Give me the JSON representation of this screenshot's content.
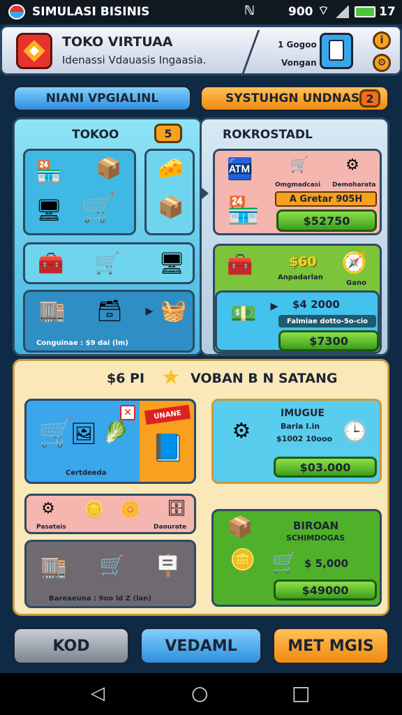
{
  "status_bar": {
    "app_title": "SIMULASI BISINIS",
    "signal_text": "900",
    "battery_text": "17"
  },
  "header": {
    "title": "TOKO VIRTUAA",
    "subtitle": "Idenassi Vdauasis Ingaasia.",
    "stat_line1": "1 Gogoo",
    "stat_line2": "Vongan"
  },
  "tabs": [
    {
      "label": "NIANI VPGIALINL",
      "color": "#3aa6ec"
    },
    {
      "label": "SYSTUHGN UNDNASIA",
      "badge": "2",
      "color": "#f9a01e"
    }
  ],
  "toko_panel": {
    "title": "TOKOO",
    "badge": "5",
    "caption": "Conguinae : $9 dai (lm)"
  },
  "rokro_panel": {
    "title": "ROKROSTADL",
    "label_left": "Omgmadcasi",
    "label_right": "Demoharata",
    "orange_text": "A Gretar 905H",
    "price1": "$52750",
    "green_amount": "$60",
    "green_label": "Anpadarlan",
    "green_label_right": "Gano",
    "inner_amount": "$4 2000",
    "inner_caption": "Falmiae dotto-5o-cio",
    "price2": "$7300"
  },
  "bonus": {
    "title_left": "$6 PI",
    "title_right": "VOBAN B N SATANG",
    "card1_caption": "Certdeeda",
    "card1_tag": "UNANE",
    "card2_title": "IMUGUE",
    "card2_line1": "Baria I.in",
    "card2_line2": "$1002 10ooo",
    "card2_price": "$03.000",
    "pink_label_left": "Pasatais",
    "pink_label_right": "Daourate",
    "dark_caption": "Bareaeuna : 9oo ld Z (lan)",
    "green_title": "BIROAN",
    "green_sub": "SCHIMDOGAS",
    "green_amount": "$ 5,000",
    "green_price": "$49000"
  },
  "bottom_buttons": [
    {
      "label": "KOD",
      "color": "#9aa3ae"
    },
    {
      "label": "VEDAML",
      "color": "#3aa6ec"
    },
    {
      "label": "MET MGIS",
      "color": "#f9a01e"
    }
  ],
  "nav": {
    "back": "◁",
    "home": "○",
    "recent": "□"
  }
}
